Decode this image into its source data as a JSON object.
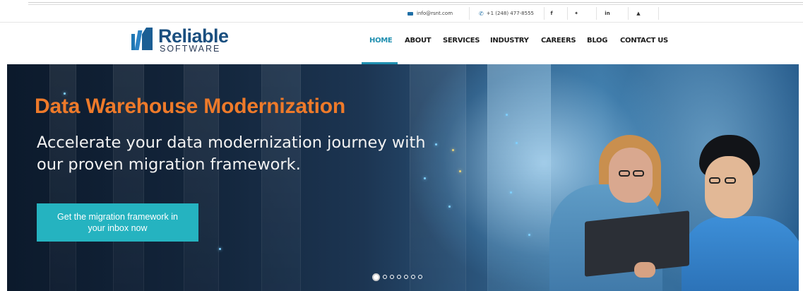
{
  "topbar": {
    "email": "info@rsnt.com",
    "phone": "+1 (248) 477-8555",
    "social": [
      {
        "icon": "facebook-icon",
        "glyph": "f"
      },
      {
        "icon": "twitter-icon",
        "glyph": "🐦"
      },
      {
        "icon": "linkedin-icon",
        "glyph": "in"
      },
      {
        "icon": "youtube-icon",
        "glyph": "▲"
      }
    ]
  },
  "logo": {
    "line1": "Reliable",
    "line2": "SOFTWARE"
  },
  "nav": {
    "items": [
      {
        "label": "HOME",
        "active": true
      },
      {
        "label": "ABOUT",
        "active": false
      },
      {
        "label": "SERVICES",
        "active": false
      },
      {
        "label": "INDUSTRY",
        "active": false
      },
      {
        "label": "CAREERS",
        "active": false
      },
      {
        "label": "BLOG",
        "active": false
      },
      {
        "label": "CONTACT US",
        "active": false
      }
    ]
  },
  "hero": {
    "title": "Data Warehouse Modernization",
    "subtitle": "Accelerate your data modernization journey with our proven migration framework.",
    "cta_label": "Get the migration framework in your inbox now",
    "slides_total": 7,
    "active_slide": 1
  },
  "colors": {
    "accent": "#1f8fb0",
    "title_orange": "#ee7a2a",
    "cta_teal": "#25b3c0"
  }
}
